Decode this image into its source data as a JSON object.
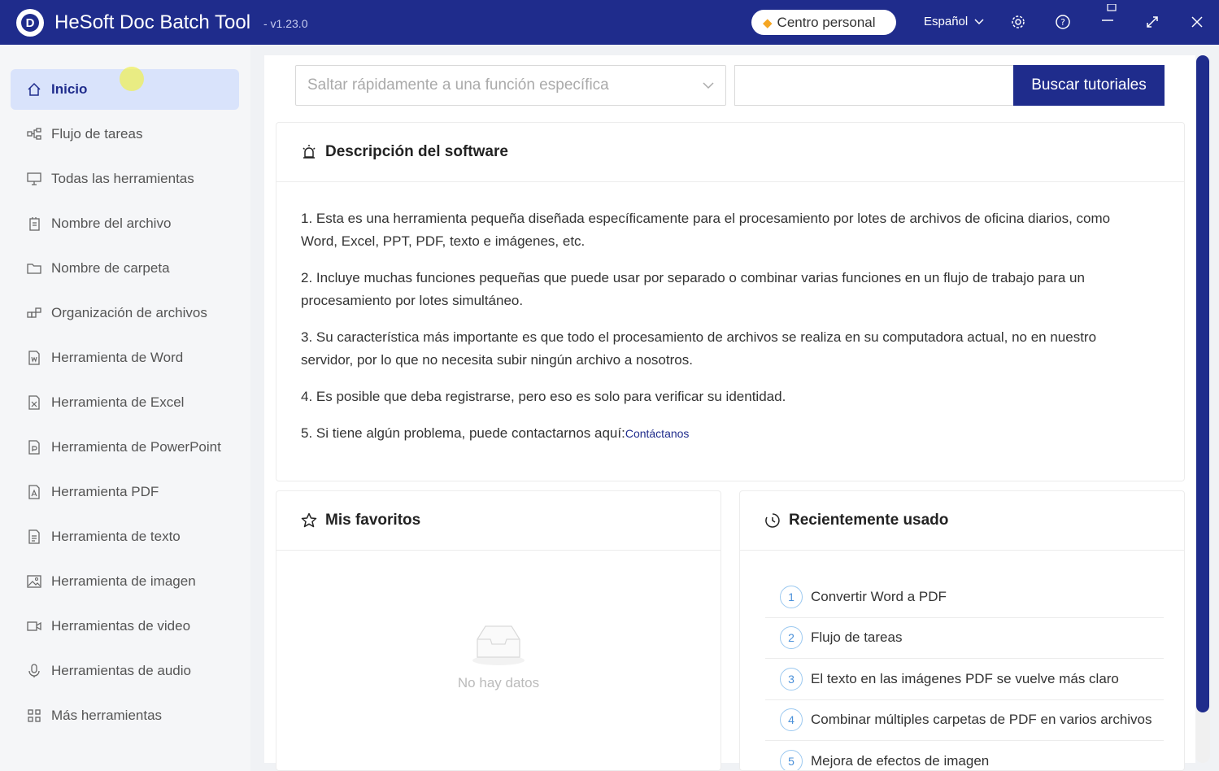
{
  "titlebar": {
    "app_title": "HeSoft Doc Batch Tool",
    "version": "- v1.23.0",
    "personal_center": "Centro personal",
    "language": "Español",
    "icons": [
      "settings-icon",
      "help-icon",
      "minimize-icon",
      "maximize-icon",
      "close-icon"
    ]
  },
  "sidebar": {
    "items": [
      {
        "label": "Inicio",
        "icon": "home-icon",
        "active": true
      },
      {
        "label": "Flujo de tareas",
        "icon": "workflow-icon"
      },
      {
        "label": "Todas las herramientas",
        "icon": "monitor-icon"
      },
      {
        "label": "Nombre del archivo",
        "icon": "file-copy-icon"
      },
      {
        "label": "Nombre de carpeta",
        "icon": "folder-icon"
      },
      {
        "label": "Organización de archivos",
        "icon": "organize-icon"
      },
      {
        "label": "Herramienta de Word",
        "icon": "word-file-icon"
      },
      {
        "label": "Herramienta de Excel",
        "icon": "excel-file-icon"
      },
      {
        "label": "Herramienta de PowerPoint",
        "icon": "ppt-file-icon"
      },
      {
        "label": "Herramienta PDF",
        "icon": "pdf-file-icon"
      },
      {
        "label": "Herramienta de texto",
        "icon": "text-file-icon"
      },
      {
        "label": "Herramienta de imagen",
        "icon": "image-icon"
      },
      {
        "label": "Herramientas de video",
        "icon": "video-icon"
      },
      {
        "label": "Herramientas de audio",
        "icon": "microphone-icon"
      },
      {
        "label": "Más herramientas",
        "icon": "grid-icon"
      }
    ]
  },
  "search": {
    "jump_placeholder": "Saltar rápidamente a una función específica",
    "tutorial_button": "Buscar tutoriales"
  },
  "description": {
    "title": "Descripción del software",
    "items": [
      "1. Esta es una herramienta pequeña diseñada específicamente para el procesamiento por lotes de archivos de oficina diarios, como Word, Excel, PPT, PDF, texto e imágenes, etc.",
      "2. Incluye muchas funciones pequeñas que puede usar por separado o combinar varias funciones en un flujo de trabajo para un procesamiento por lotes simultáneo.",
      "3. Su característica más importante es que todo el procesamiento de archivos se realiza en su computadora actual, no en nuestro servidor, por lo que no necesita subir ningún archivo a nosotros.",
      "4. Es posible que deba registrarse, pero eso es solo para verificar su identidad."
    ],
    "item5_text": "5. Si tiene algún problema, puede contactarnos aquí:",
    "item5_link": "Contáctanos"
  },
  "favorites": {
    "title": "Mis favoritos",
    "empty_text": "No hay datos"
  },
  "recent": {
    "title": "Recientemente usado",
    "items": [
      {
        "num": "1",
        "label": "Convertir Word a PDF"
      },
      {
        "num": "2",
        "label": "Flujo de tareas"
      },
      {
        "num": "3",
        "label": "El texto en las imágenes PDF se vuelve más claro"
      },
      {
        "num": "4",
        "label": "Combinar múltiples carpetas de PDF en varios archivos"
      },
      {
        "num": "5",
        "label": "Mejora de efectos de imagen"
      }
    ]
  },
  "colors": {
    "brand": "#1f2c8c",
    "active_bg": "#d9e3fb"
  }
}
